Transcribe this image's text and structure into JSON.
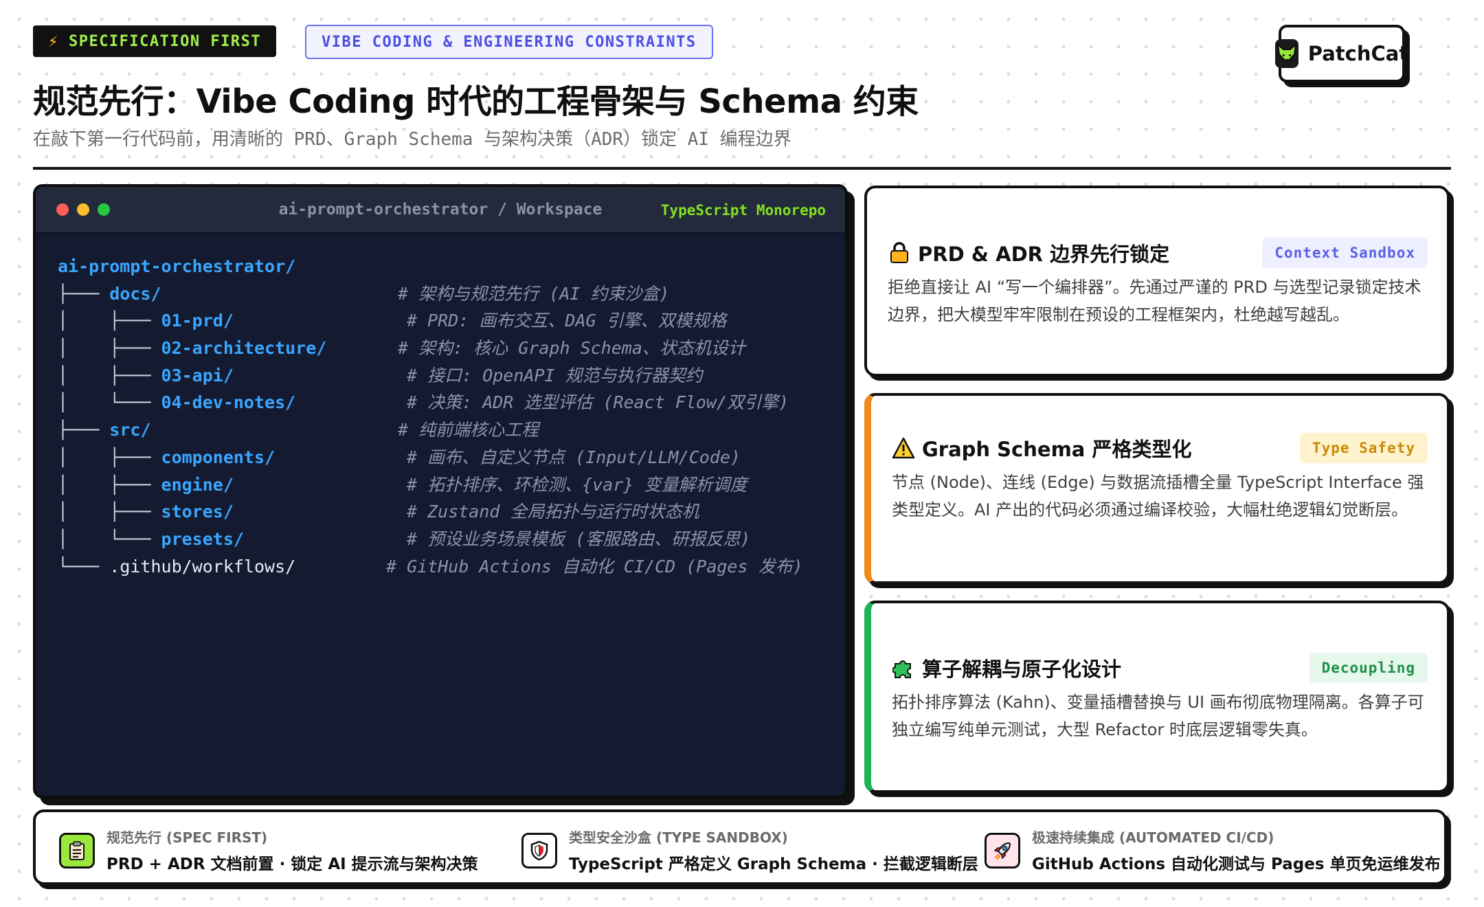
{
  "header": {
    "tag_primary": "SPECIFICATION FIRST",
    "tag_primary_icon": "lightning-icon",
    "tag_secondary": "VIBE CODING & ENGINEERING CONSTRAINTS",
    "title": "规范先行：Vibe Coding 时代的工程骨架与 Schema 约束",
    "subtitle": "在敲下第一行代码前，用清晰的 PRD、Graph Schema 与架构决策（ADR）锁定 AI 编程边界"
  },
  "brand": {
    "name": "PatchCat",
    "logo_icon": "fox-head-icon"
  },
  "terminal": {
    "title": "ai-prompt-orchestrator / Workspace",
    "badge": "TypeScript Monorepo",
    "tree": [
      {
        "prefix": "",
        "name": "ai-prompt-orchestrator/",
        "comment": ""
      },
      {
        "prefix": "├─── ",
        "name": "docs/",
        "comment": "# 架构与规范先行 (AI 约束沙盒)"
      },
      {
        "prefix": "│    ├─── ",
        "name": "01-prd/",
        "comment": "# PRD: 画布交互、DAG 引擎、双模规格"
      },
      {
        "prefix": "│    ├─── ",
        "name": "02-architecture/",
        "comment": "# 架构: 核心 Graph Schema、状态机设计"
      },
      {
        "prefix": "│    ├─── ",
        "name": "03-api/",
        "comment": "# 接口: OpenAPI 规范与执行器契约"
      },
      {
        "prefix": "│    └─── ",
        "name": "04-dev-notes/",
        "comment": "# 决策: ADR 选型评估 (React Flow/双引擎)"
      },
      {
        "prefix": "├─── ",
        "name": "src/",
        "comment": "# 纯前端核心工程"
      },
      {
        "prefix": "│    ├─── ",
        "name": "components/",
        "comment": "# 画布、自定义节点 (Input/LLM/Code)"
      },
      {
        "prefix": "│    ├─── ",
        "name": "engine/",
        "comment": "# 拓扑排序、环检测、{var} 变量解析调度"
      },
      {
        "prefix": "│    ├─── ",
        "name": "stores/",
        "comment": "# Zustand 全局拓扑与运行时状态机"
      },
      {
        "prefix": "│    └─── ",
        "name": "presets/",
        "comment": "# 预设业务场景模板 (客服路由、研报反思)"
      },
      {
        "prefix": "└─── ",
        "name": ".github/workflows/",
        "comment": "# GitHub Actions 自动化 CI/CD (Pages 发布)"
      }
    ]
  },
  "cards": [
    {
      "icon": "lock-icon",
      "title": "PRD & ADR 边界先行锁定",
      "badge": "Context Sandbox",
      "body": "拒绝直接让 AI “写一个编排器”。先通过严谨的 PRD 与选型记录锁定技术边界，把大模型牢牢限制在预设的工程框架内，杜绝越写越乱。"
    },
    {
      "icon": "warning-icon",
      "title": "Graph Schema 严格类型化",
      "badge": "Type Safety",
      "body": "节点 (Node)、连线 (Edge) 与数据流插槽全量 TypeScript Interface 强类型定义。AI 产出的代码必须通过编译校验，大幅杜绝逻辑幻觉断层。"
    },
    {
      "icon": "puzzle-icon",
      "title": "算子解耦与原子化设计",
      "badge": "Decoupling",
      "body": "拓扑排序算法 (Kahn)、变量插槽替换与 UI 画布彻底物理隔离。各算子可独立编写纯单元测试，大型 Refactor 时底层逻辑零失真。"
    }
  ],
  "footer": [
    {
      "icon": "clipboard-icon",
      "label": "规范先行 (SPEC FIRST)",
      "desc": "PRD + ADR 文档前置 · 锁定 AI 提示流与架构决策"
    },
    {
      "icon": "shield-icon",
      "label": "类型安全沙盒 (TYPE SANDBOX)",
      "desc": "TypeScript 严格定义 Graph Schema · 拦截逻辑断层"
    },
    {
      "icon": "rocket-icon",
      "label": "极速持续集成 (AUTOMATED CI/CD)",
      "desc": "GitHub Actions 自动化测试与 Pages 单页免运维发布"
    }
  ],
  "colors": {
    "accent_lime": "#a3f04a",
    "accent_indigo": "#6d70f0",
    "terminal_bg": "#141b30",
    "dir_blue": "#3aa6ff",
    "card_orange": "#f08a1c",
    "card_green": "#1fb35a"
  }
}
